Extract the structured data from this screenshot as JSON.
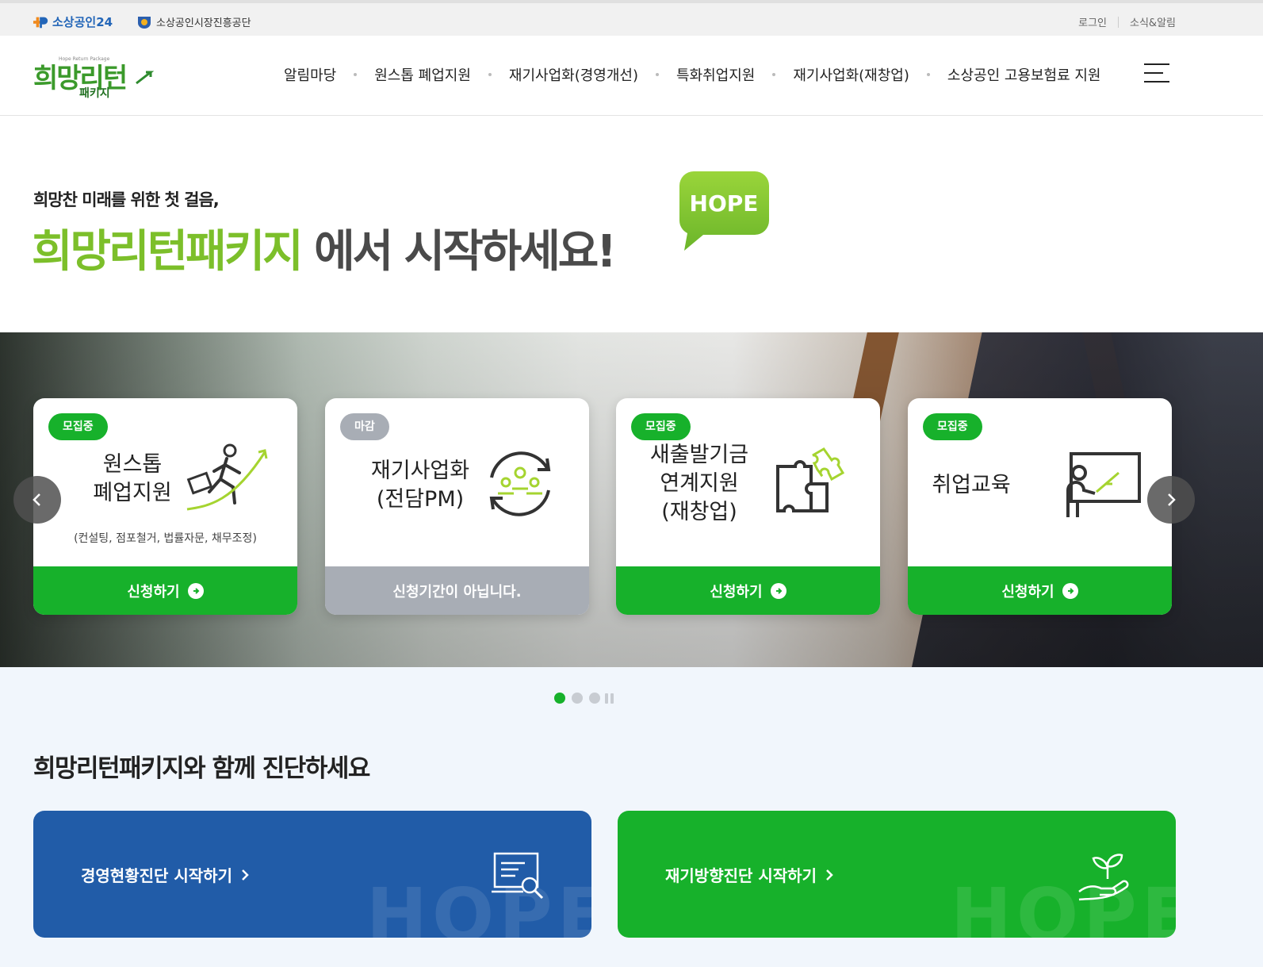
{
  "topbar": {
    "brand1": "소상공인24",
    "brand2": "소상공인시장진흥공단",
    "login": "로그인",
    "news": "소식&알림"
  },
  "logo": {
    "main": "희망리턴",
    "sub": "패키지",
    "tiny": "Hope Return Package"
  },
  "nav": {
    "items": [
      {
        "label": "알림마당"
      },
      {
        "label": "원스톱 폐업지원"
      },
      {
        "label": "재기사업화(경영개선)"
      },
      {
        "label": "특화취업지원"
      },
      {
        "label": "재기사업화(재창업)"
      },
      {
        "label": "소상공인 고용보험료 지원"
      }
    ]
  },
  "hero": {
    "small": "희망찬 미래를 위한 첫 걸음,",
    "big_green": "희망리턴패키지",
    "big_gray": " 에서 시작하세요!",
    "bubble": "HOPE"
  },
  "cards": [
    {
      "badge": "모집중",
      "title_line1": "원스톱",
      "title_line2": "폐업지원",
      "desc": "(컨설팅, 점포철거, 법률자문, 채무조정)",
      "cta": "신청하기",
      "icon": "running-businessman-icon"
    },
    {
      "badge": "마감",
      "title_line1": "재기사업화",
      "title_line2": "(전담PM)",
      "cta": "신청기간이 아닙니다.",
      "icon": "team-cycle-icon"
    },
    {
      "badge": "모집중",
      "title_line1": "새출발기금",
      "title_line2": "연계지원",
      "title_line3": "(재창업)",
      "cta": "신청하기",
      "icon": "puzzle-icon"
    },
    {
      "badge": "모집중",
      "title_line1": "취업교육",
      "cta": "신청하기",
      "icon": "teacher-board-icon"
    }
  ],
  "section": {
    "title": "희망리턴패키지와 함께 진단하세요"
  },
  "diagnosis": [
    {
      "label": "경영현황진단 시작하기",
      "watermark": "HOPE",
      "icon": "document-search-icon"
    },
    {
      "label": "재기방향진단 시작하기",
      "watermark": "HOPE",
      "icon": "plant-hand-icon"
    }
  ],
  "colors": {
    "accent_green": "#17b12b",
    "hero_green": "#7cbf2a",
    "blue": "#215ca8",
    "closed_gray": "#a8adb5"
  }
}
